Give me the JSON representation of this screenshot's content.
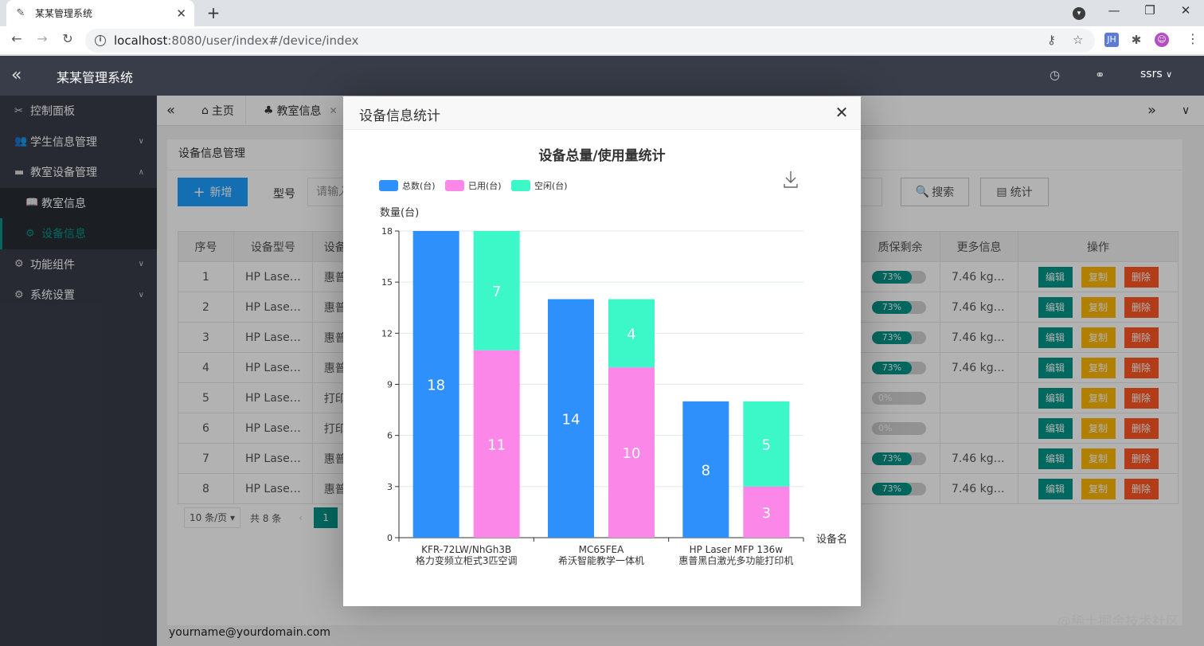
{
  "browser": {
    "tab_title": "某某管理系统",
    "url_host": "localhost",
    "url_path": ":8080/user/index#/device/index",
    "ext_label": "JH"
  },
  "app": {
    "title": "某某管理系统",
    "user": "ssrs",
    "footer_email": "yourname@yourdomain.com",
    "watermark": "@稀土掘金技术社区"
  },
  "sidebar": {
    "items": [
      {
        "label": "控制面板"
      },
      {
        "label": "学生信息管理"
      },
      {
        "label": "教室设备管理"
      },
      {
        "label": "教室信息"
      },
      {
        "label": "设备信息"
      },
      {
        "label": "功能组件"
      },
      {
        "label": "系统设置"
      }
    ]
  },
  "tabs": [
    {
      "label": "主页"
    },
    {
      "label": "教室信息"
    }
  ],
  "page": {
    "card_title": "设备信息管理",
    "add_label": "新增",
    "model_label": "型号",
    "model_placeholder": "请输入",
    "search_label": "搜索",
    "stats_label": "统计"
  },
  "table": {
    "headers": [
      "序号",
      "设备型号",
      "设备"
    ],
    "rows": [
      [
        "1",
        "HP Lase…",
        "惠普"
      ],
      [
        "2",
        "HP Lase…",
        "惠普"
      ],
      [
        "3",
        "HP Lase…",
        "惠普"
      ],
      [
        "4",
        "HP Lase…",
        "惠普"
      ],
      [
        "5",
        "HP Lase…",
        "打印"
      ],
      [
        "6",
        "HP Lase…",
        "打印"
      ],
      [
        "7",
        "HP Lase…",
        "惠普"
      ],
      [
        "8",
        "HP Lase…",
        "惠普"
      ]
    ],
    "right_headers": [
      "质保剩余",
      "更多信息",
      "操作"
    ],
    "right_rows": [
      {
        "warranty": 73,
        "warranty_text": "73%",
        "more": "7.46 kg…"
      },
      {
        "warranty": 73,
        "warranty_text": "73%",
        "more": "7.46 kg…"
      },
      {
        "warranty": 73,
        "warranty_text": "73%",
        "more": "7.46 kg…"
      },
      {
        "warranty": 73,
        "warranty_text": "73%",
        "more": "7.46 kg…"
      },
      {
        "warranty": 0,
        "warranty_text": "0%",
        "more": ""
      },
      {
        "warranty": 0,
        "warranty_text": "0%",
        "more": ""
      },
      {
        "warranty": 73,
        "warranty_text": "73%",
        "more": "7.46 kg…"
      },
      {
        "warranty": 73,
        "warranty_text": "73%",
        "more": "7.46 kg…"
      }
    ],
    "actions": {
      "edit": "编辑",
      "copy": "复制",
      "delete": "删除"
    }
  },
  "pager": {
    "page_size": "10 条/页",
    "total": "共 8 条",
    "current": "1"
  },
  "modal": {
    "title": "设备信息统计"
  },
  "chart_data": {
    "type": "bar",
    "title": "设备总量/使用量统计",
    "ylabel": "数量(台)",
    "xlabel": "设备名",
    "ylim": [
      0,
      18
    ],
    "yticks": [
      0,
      3,
      6,
      9,
      12,
      15,
      18
    ],
    "categories": [
      [
        "KFR-72LW/NhGh3B",
        "格力变频立柜式3匹空调"
      ],
      [
        "MC65FEA",
        "希沃智能教学一体机"
      ],
      [
        "HP Laser MFP 136w",
        "惠普黑白激光多功能打印机"
      ]
    ],
    "series": [
      {
        "name": "总数(台)",
        "color": "#2e90fa",
        "values": [
          18,
          14,
          8
        ],
        "stack": "total"
      },
      {
        "name": "已用(台)",
        "color": "#fb88e8",
        "values": [
          11,
          10,
          3
        ],
        "stack": "use"
      },
      {
        "name": "空闲(台)",
        "color": "#3cf7c8",
        "values": [
          7,
          4,
          5
        ],
        "stack": "use"
      }
    ],
    "legend_position": "top-left",
    "grid": true
  }
}
